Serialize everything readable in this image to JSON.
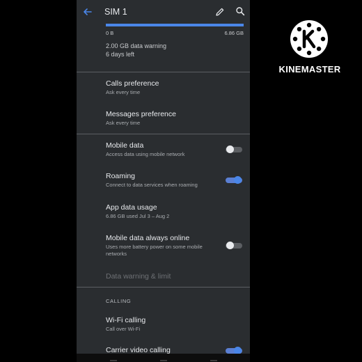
{
  "header": {
    "title": "SIM 1",
    "back_icon": "arrow-back-icon",
    "edit_icon": "pencil-icon",
    "search_icon": "search-icon"
  },
  "usage": {
    "min_label": "0 B",
    "max_label": "6.86 GB",
    "used_fraction": 1.0,
    "warning_text": "2.00 GB data warning",
    "days_left_text": "6 days left"
  },
  "settings": {
    "calls_preference": {
      "title": "Calls preference",
      "subtitle": "Ask every time"
    },
    "messages_preference": {
      "title": "Messages preference",
      "subtitle": "Ask every time"
    },
    "mobile_data": {
      "title": "Mobile data",
      "subtitle": "Access data using mobile network",
      "enabled": false
    },
    "roaming": {
      "title": "Roaming",
      "subtitle": "Connect to data services when roaming",
      "enabled": true
    },
    "app_data_usage": {
      "title": "App data usage",
      "subtitle": "6.86 GB used Jul 3 – Aug 2"
    },
    "always_online": {
      "title": "Mobile data always online",
      "subtitle": "Uses more battery power on some mobile networks",
      "enabled": false
    },
    "data_warning_limit": {
      "title": "Data warning & limit"
    },
    "calling_section": "CALLING",
    "wifi_calling": {
      "title": "Wi-Fi calling",
      "subtitle": "Call over Wi-Fi"
    },
    "carrier_video_calling": {
      "title": "Carrier video calling",
      "enabled": true
    }
  },
  "watermark": {
    "brand": "KINEMASTER",
    "icon": "kinemaster-logo-icon"
  },
  "colors": {
    "accent": "#4a86e8",
    "background": "#2a2d30",
    "text": "#e8eaed",
    "secondary_text": "#a9acb0"
  }
}
